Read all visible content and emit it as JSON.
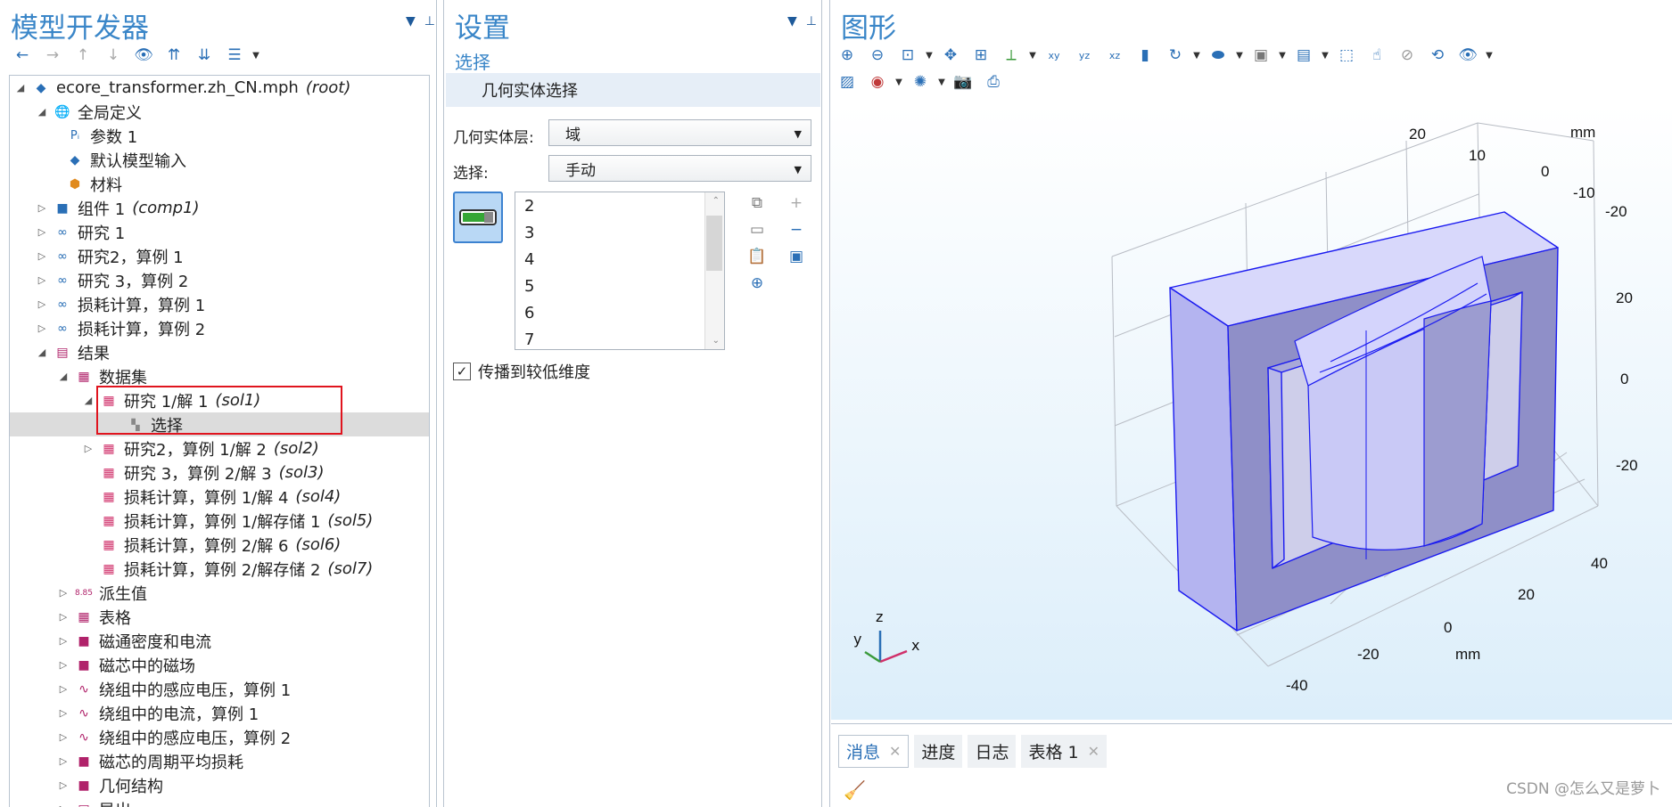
{
  "model_builder": {
    "title": "模型开发器",
    "tree": [
      {
        "label": "ecore_transformer.zh_CN.mph",
        "tag": "(root)",
        "icon": "model-icon"
      },
      {
        "label": "全局定义",
        "icon": "globe-icon"
      },
      {
        "label": "参数 1",
        "icon": "parameters-icon"
      },
      {
        "label": "默认模型输入",
        "icon": "model-input-icon"
      },
      {
        "label": "材料",
        "icon": "materials-icon"
      },
      {
        "label": "组件 1",
        "tag": "(comp1)",
        "icon": "component-icon"
      },
      {
        "label": "研究 1",
        "icon": "study-icon"
      },
      {
        "label": "研究2，算例 1",
        "icon": "study-icon"
      },
      {
        "label": "研究 3，算例 2",
        "icon": "study-icon"
      },
      {
        "label": "损耗计算，算例 1",
        "icon": "study-icon"
      },
      {
        "label": "损耗计算，算例 2",
        "icon": "study-icon"
      },
      {
        "label": "结果",
        "icon": "results-icon"
      },
      {
        "label": "数据集",
        "icon": "datasets-icon"
      },
      {
        "label": "研究 1/解 1",
        "tag": "(sol1)",
        "icon": "solution-icon"
      },
      {
        "label": "选择",
        "icon": "selection-icon"
      },
      {
        "label": "研究2，算例 1/解 2",
        "tag": "(sol2)",
        "icon": "solution-icon"
      },
      {
        "label": "研究 3，算例 2/解 3",
        "tag": "(sol3)",
        "icon": "solution-icon"
      },
      {
        "label": "损耗计算，算例 1/解 4",
        "tag": "(sol4)",
        "icon": "solution-icon"
      },
      {
        "label": "损耗计算，算例 1/解存储 1",
        "tag": "(sol5)",
        "icon": "solution-icon"
      },
      {
        "label": "损耗计算，算例 2/解 6",
        "tag": "(sol6)",
        "icon": "solution-icon"
      },
      {
        "label": "损耗计算，算例 2/解存储 2",
        "tag": "(sol7)",
        "icon": "solution-icon"
      },
      {
        "label": "派生值",
        "icon": "derived-values-icon"
      },
      {
        "label": "表格",
        "icon": "table-icon"
      },
      {
        "label": "磁通密度和电流",
        "icon": "plot-group-icon"
      },
      {
        "label": "磁芯中的磁场",
        "icon": "plot-group-icon"
      },
      {
        "label": "绕组中的感应电压，算例 1",
        "icon": "1d-plot-icon"
      },
      {
        "label": "绕组中的电流，算例 1",
        "icon": "1d-plot-icon"
      },
      {
        "label": "绕组中的感应电压，算例 2",
        "icon": "1d-plot-icon"
      },
      {
        "label": "磁芯的周期平均损耗",
        "icon": "plot-group-icon"
      },
      {
        "label": "几何结构",
        "icon": "plot-group-icon"
      },
      {
        "label": "导出",
        "icon": "export-icon"
      }
    ]
  },
  "settings": {
    "title": "设置",
    "subtitle": "选择",
    "section": "几何实体选择",
    "level_label": "几何实体层:",
    "level_value": "域",
    "selection_label": "选择:",
    "selection_value": "手动",
    "list_items": [
      "2",
      "3",
      "4",
      "5",
      "6",
      "7"
    ],
    "propagate_label": "传播到较低维度",
    "propagate_checked": true
  },
  "graphics": {
    "title": "图形",
    "axis_unit": "mm",
    "tick_labels": {
      "top": [
        "20",
        "10",
        "0",
        "-10",
        "-20"
      ],
      "right": [
        "20",
        "0",
        "-20"
      ],
      "front": [
        "40",
        "20",
        "0",
        "-20",
        "-40"
      ]
    },
    "triad": {
      "x": "x",
      "y": "y",
      "z": "z"
    }
  },
  "messages": {
    "tabs": [
      "消息",
      "进度",
      "日志",
      "表格 1"
    ]
  },
  "watermark": "CSDN @怎么又是萝卜",
  "colors": {
    "accent": "#3a86c8",
    "highlight_box": "#e0141e",
    "body_fill": "#c8c8f8"
  }
}
